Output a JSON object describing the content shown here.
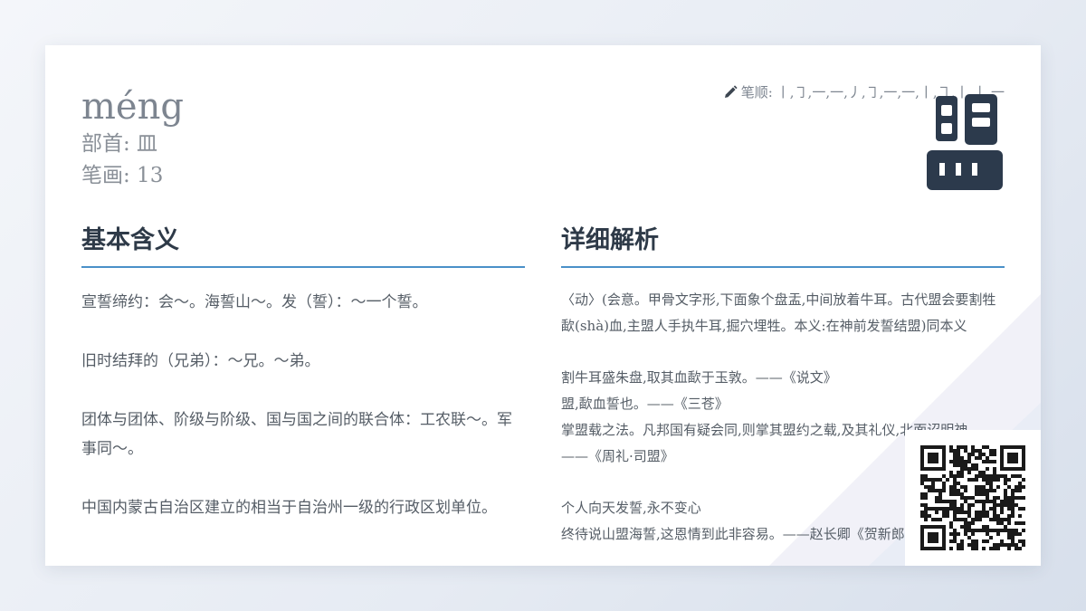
{
  "header": {
    "pinyin": "méng",
    "radical": "部首: 皿",
    "strokes": "笔画: 13",
    "stroke_order_label": "笔顺:",
    "stroke_order": "丨,㇆,一,一,丿,㇆,一,一,丨,㇆,丨,丨,一"
  },
  "character": "盟",
  "basic": {
    "title": "基本含义",
    "items": [
      "宣誓缔约：会～。海誓山～。发（誓）：～一个誓。",
      "旧时结拜的（兄弟）：～兄。～弟。",
      "团体与团体、阶级与阶级、国与国之间的联合体：工农联～。军事同～。",
      "中国内蒙古自治区建立的相当于自治州一级的行政区划单位。"
    ]
  },
  "detail": {
    "title": "详细解析",
    "paragraphs": [
      [
        "〈动〉(会意。甲骨文字形,下面象个盘盂,中间放着牛耳。古代盟会要割牲歃(shà)血,主盟人手执牛耳,掘穴埋牲。本义:在神前发誓结盟)同本义"
      ],
      [
        "割牛耳盛朱盘,取其血歃于玉敦。——《说文》",
        "盟,歃血誓也。——《三苍》",
        "掌盟载之法。凡邦国有疑会同,则掌其盟约之载,及其礼仪,北面诏明神。——《周礼·司盟》"
      ],
      [
        "个人向天发誓,永不变心",
        "终待说山盟海誓,这恩情到此非容易。——赵长卿《贺新郎》"
      ]
    ]
  },
  "colors": {
    "accent": "#4a90c8",
    "title": "#2e3a48",
    "character": "#2c3a4c"
  },
  "icons": {
    "stroke_order": "pencil-icon",
    "qr": "qr-code-icon"
  }
}
